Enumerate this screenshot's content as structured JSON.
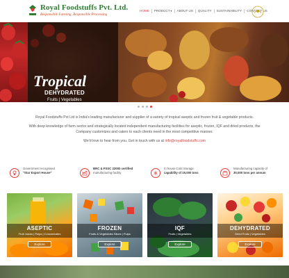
{
  "brand": {
    "name": "Royal Foodstuffs Pvt. Ltd.",
    "tagline": "Responsible Farming, Responsible Processing"
  },
  "nav": {
    "items": [
      "HOME",
      "PRODUCT",
      "ABOUT US",
      "QUALITY",
      "SUSTAINABILITY",
      "CONTACT US"
    ],
    "active": "HOME"
  },
  "hero": {
    "title": "Tropical",
    "subtitle": "DEHYDRATED",
    "caption": "Fruits | Vegetables",
    "slides_total": 4,
    "slide_active": 4
  },
  "intro": {
    "p1": "Royal Foodstuffs Pvt Ltd is India's leading manufacturer and supplier of a variety of tropical aseptic and frozen fruit & vegetable products.",
    "p2": "With deep knowledge of farm sector and strategically located independent manufacturing facilities for aseptic, frozen, IQF and dried products, the Company customizes and caters to each clients need in the most competitive manner.",
    "p3_prefix": "We'd love to hear from you. Get in touch with us at ",
    "email": "info@royalfoodstuffs.com"
  },
  "features": [
    {
      "line1": "Government recognised",
      "line2": "\"Star Export House\"",
      "icon": "award-icon"
    },
    {
      "line1": "BRC & FSSC 22000 certified",
      "line2": "manufacturing facility",
      "icon": "factory-icon"
    },
    {
      "line1": "In house Cold Storage",
      "line2": "capability of 15,000 tons",
      "icon": "cold-storage-icon"
    },
    {
      "line1": "Manufacturing capacity of",
      "line2": "30,000 tons per annum",
      "icon": "capacity-icon"
    }
  ],
  "cards": [
    {
      "title": "ASEPTIC",
      "sub": "Fruit Juices | Pulps | Concentrates",
      "button": "Explore"
    },
    {
      "title": "FROZEN",
      "sub": "Fruits & Vegetables Slices | Pulps",
      "button": "Explore"
    },
    {
      "title": "IQF",
      "sub": "Fruits | Vegetables",
      "button": "Explore"
    },
    {
      "title": "DEHYDRATED",
      "sub": "Dried Fruits | Vegetables",
      "button": "Explore"
    }
  ],
  "colors": {
    "brand_green": "#2e7d32",
    "accent_red": "#e53935",
    "tagline_orange": "#d84315"
  }
}
